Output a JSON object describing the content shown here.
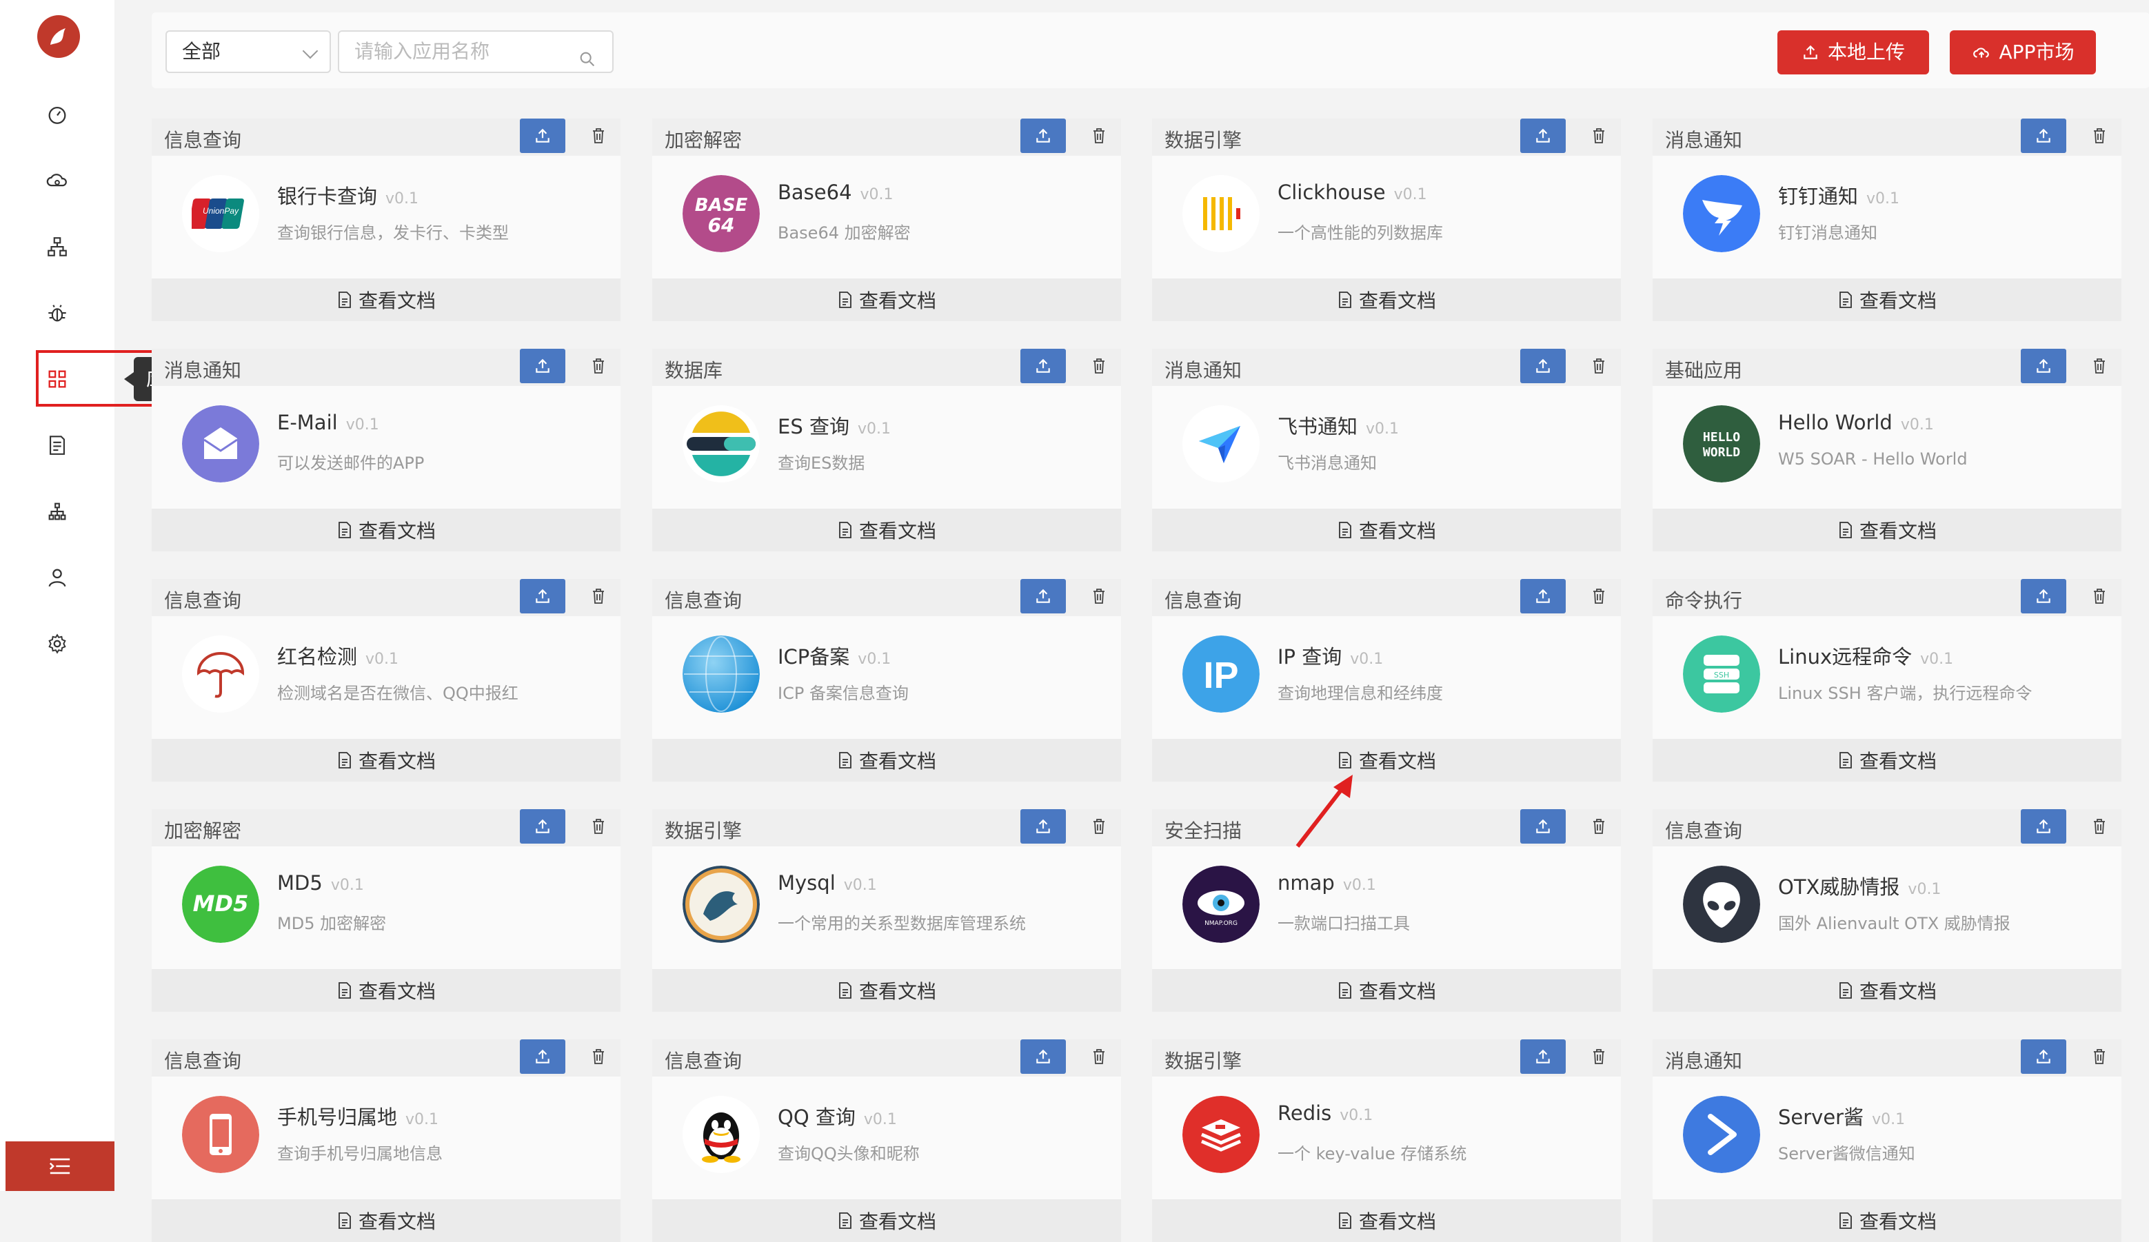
{
  "tooltip": "应用中心",
  "toolbar": {
    "filter_value": "全部",
    "search_placeholder": "请输入应用名称",
    "local_upload_label": "本地上传",
    "app_market_label": "APP市场"
  },
  "colors": {
    "brand_red": "#d9302b",
    "upload_blue": "#4a78c2"
  },
  "doc_label": "查看文档",
  "cards": [
    {
      "category": "信息查询",
      "name": "银行卡查询",
      "version": "v0.1",
      "desc": "查询银行信息，发卡行、卡类型",
      "icon": "unionpay-icon"
    },
    {
      "category": "加密解密",
      "name": "Base64",
      "version": "v0.1",
      "desc": "Base64 加密解密",
      "icon": "base64-icon"
    },
    {
      "category": "数据引擎",
      "name": "Clickhouse",
      "version": "v0.1",
      "desc": "一个高性能的列数据库",
      "icon": "clickhouse-icon"
    },
    {
      "category": "消息通知",
      "name": "钉钉通知",
      "version": "v0.1",
      "desc": "钉钉消息通知",
      "icon": "dingtalk-icon"
    },
    {
      "category": "消息通知",
      "name": "E-Mail",
      "version": "v0.1",
      "desc": "可以发送邮件的APP",
      "icon": "email-icon"
    },
    {
      "category": "数据库",
      "name": "ES 查询",
      "version": "v0.1",
      "desc": "查询ES数据",
      "icon": "elasticsearch-icon"
    },
    {
      "category": "消息通知",
      "name": "飞书通知",
      "version": "v0.1",
      "desc": "飞书消息通知",
      "icon": "feishu-icon"
    },
    {
      "category": "基础应用",
      "name": "Hello World",
      "version": "v0.1",
      "desc": "W5 SOAR - Hello World",
      "icon": "hello-world-icon"
    },
    {
      "category": "信息查询",
      "name": "红名检测",
      "version": "v0.1",
      "desc": "检测域名是否在微信、QQ中报红",
      "icon": "umbrella-icon"
    },
    {
      "category": "信息查询",
      "name": "ICP备案",
      "version": "v0.1",
      "desc": "ICP 备案信息查询",
      "icon": "globe-icon"
    },
    {
      "category": "信息查询",
      "name": "IP 查询",
      "version": "v0.1",
      "desc": "查询地理信息和经纬度",
      "icon": "ip-icon"
    },
    {
      "category": "命令执行",
      "name": "Linux远程命令",
      "version": "v0.1",
      "desc": "Linux SSH 客户端，执行远程命令",
      "icon": "ssh-icon"
    },
    {
      "category": "加密解密",
      "name": "MD5",
      "version": "v0.1",
      "desc": "MD5 加密解密",
      "icon": "md5-icon"
    },
    {
      "category": "数据引擎",
      "name": "Mysql",
      "version": "v0.1",
      "desc": "一个常用的关系型数据库管理系统",
      "icon": "mysql-icon"
    },
    {
      "category": "安全扫描",
      "name": "nmap",
      "version": "v0.1",
      "desc": "一款端口扫描工具",
      "icon": "nmap-icon"
    },
    {
      "category": "信息查询",
      "name": "OTX威胁情报",
      "version": "v0.1",
      "desc": "国外 Alienvault OTX 威胁情报",
      "icon": "alien-icon"
    },
    {
      "category": "信息查询",
      "name": "手机号归属地",
      "version": "v0.1",
      "desc": "查询手机号归属地信息",
      "icon": "phone-icon"
    },
    {
      "category": "信息查询",
      "name": "QQ 查询",
      "version": "v0.1",
      "desc": "查询QQ头像和昵称",
      "icon": "qq-icon"
    },
    {
      "category": "数据引擎",
      "name": "Redis",
      "version": "v0.1",
      "desc": "一个 key-value 存储系统",
      "icon": "redis-icon"
    },
    {
      "category": "消息通知",
      "name": "Server酱",
      "version": "v0.1",
      "desc": "Server酱微信通知",
      "icon": "serverchan-icon"
    }
  ]
}
